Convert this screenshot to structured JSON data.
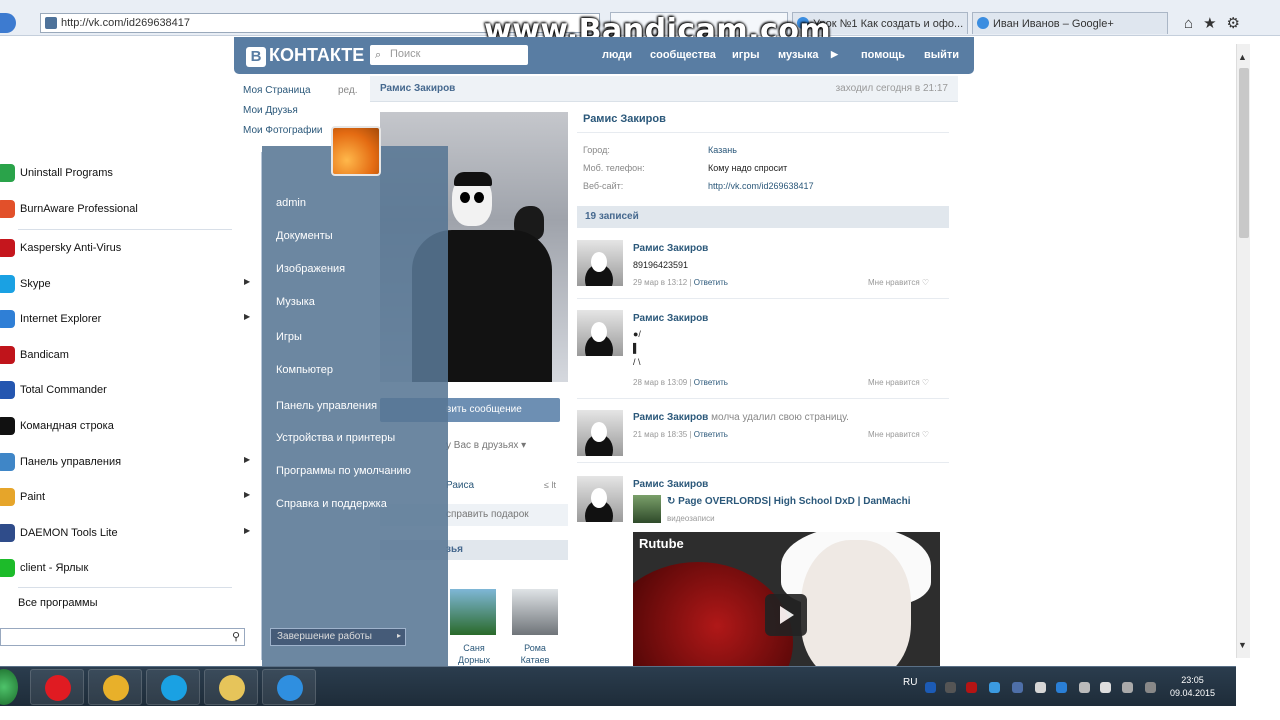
{
  "browser": {
    "url": "http://vk.com/id269638417",
    "tabs": [
      "Урок №1 Как создать и офо...",
      "Иван Иванов – Google+"
    ],
    "watermark": "www.Bandicam.com"
  },
  "vk": {
    "logo": "КОНТАКТЕ",
    "logo_letter": "В",
    "search_placeholder": "Поиск",
    "nav": [
      "люди",
      "сообщества",
      "игры",
      "музыка",
      "помощь",
      "выйти"
    ],
    "left_menu": [
      {
        "label": "Моя Страница",
        "extra": "ред."
      },
      {
        "label": "Мои Друзья"
      },
      {
        "label": "Мои Фотографии"
      }
    ],
    "header_name": "Рамис Закиров",
    "online": "заходил сегодня в 21:17",
    "profile": {
      "name": "Рамис Закиров",
      "fields": [
        {
          "label": "Город:",
          "value": "Казань"
        },
        {
          "label": "Моб. телефон:",
          "value": "Кому надо спросит"
        },
        {
          "label": "Веб-сайт:",
          "value": "http://vk.com/id269638417"
        }
      ]
    },
    "wall_count": "19 записей",
    "send_message": "вить сообщение",
    "in_friends": "у Вас в друзьях",
    "friend_name": "Раиса",
    "gift": "справить подарок",
    "friends_block": "зья",
    "friends": [
      {
        "first": "Саня",
        "last": "Дорных"
      },
      {
        "first": "Рома",
        "last": "Катаев"
      }
    ],
    "posts": [
      {
        "author": "Рамис Закиров",
        "text": "89196423591",
        "date": "29 мар в 13:12",
        "reply": "Ответить",
        "like": "Мне нравится"
      },
      {
        "author": "Рамис Закиров",
        "text_lines": [
          "●/",
          "▌",
          "/ \\"
        ],
        "date": "28 мар в 13:09",
        "reply": "Ответить",
        "like": "Мне нравится"
      },
      {
        "author": "Рамис Закиров",
        "text": "молча удалил свою страницу.",
        "date": "21 мар в 18:35",
        "reply": "Ответить",
        "like": "Мне нравится"
      },
      {
        "author": "Рамис Закиров",
        "repost": "Page OVERLORDS| High School DxD | DanMachi",
        "sub": "видеозаписи",
        "video_brand": "Rutube"
      }
    ]
  },
  "start_menu": {
    "left_items": [
      {
        "label": "Uninstall Programs",
        "color": "#2aa34a",
        "arrow": false
      },
      {
        "label": "BurnAware Professional",
        "color": "#e2502a",
        "arrow": false
      },
      {
        "label": "Kaspersky Anti-Virus",
        "color": "#c5161d",
        "arrow": false
      },
      {
        "label": "Skype",
        "color": "#1aa1e3",
        "arrow": true
      },
      {
        "label": "Internet Explorer",
        "color": "#2f7fd6",
        "arrow": true
      },
      {
        "label": "Bandicam",
        "color": "#c0141b",
        "arrow": false
      },
      {
        "label": "Total Commander",
        "color": "#2456b0",
        "arrow": false
      },
      {
        "label": "Командная строка",
        "color": "#111111",
        "arrow": false
      },
      {
        "label": "Панель управления",
        "color": "#3f86c7",
        "arrow": true
      },
      {
        "label": "Paint",
        "color": "#e6a52a",
        "arrow": true
      },
      {
        "label": "DAEMON Tools Lite",
        "color": "#2f4c8a",
        "arrow": true
      },
      {
        "label": "client - Ярлык",
        "color": "#1dbb2a",
        "arrow": false
      }
    ],
    "all_programs": "Все программы",
    "right_items": [
      "admin",
      "Документы",
      "Изображения",
      "Музыка",
      "Игры",
      "Компьютер",
      "Панель управления",
      "Устройства и принтеры",
      "Программы по умолчанию",
      "Справка и поддержка"
    ],
    "shutdown": "Завершение работы"
  },
  "taskbar": {
    "apps": [
      {
        "icon": "opera-icon",
        "color": "#e01b22"
      },
      {
        "icon": "chrome-icon",
        "color": "#e8b02a"
      },
      {
        "icon": "skype-icon",
        "color": "#1aa1e3"
      },
      {
        "icon": "explorer-icon",
        "color": "#e6c45a"
      },
      {
        "icon": "ie-icon",
        "color": "#2f8fe0"
      }
    ],
    "lang": "RU",
    "time": "23:05",
    "date": "09.04.2015"
  }
}
